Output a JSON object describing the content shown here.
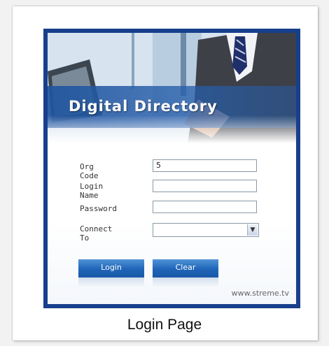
{
  "header": {
    "title": "Digital Directory"
  },
  "form": {
    "org_code": {
      "label": "Org Code",
      "value": "5"
    },
    "login_name": {
      "label": "Login Name",
      "value": ""
    },
    "password": {
      "label": "Password",
      "value": ""
    },
    "connect_to": {
      "label": "Connect To",
      "selected": ""
    }
  },
  "buttons": {
    "login": "Login",
    "clear": "Clear"
  },
  "footer": {
    "website": "www.streme.tv"
  },
  "caption": "Login Page",
  "colors": {
    "frame": "#173f8c",
    "button": "#1f64b8",
    "band": "#2055a0"
  }
}
